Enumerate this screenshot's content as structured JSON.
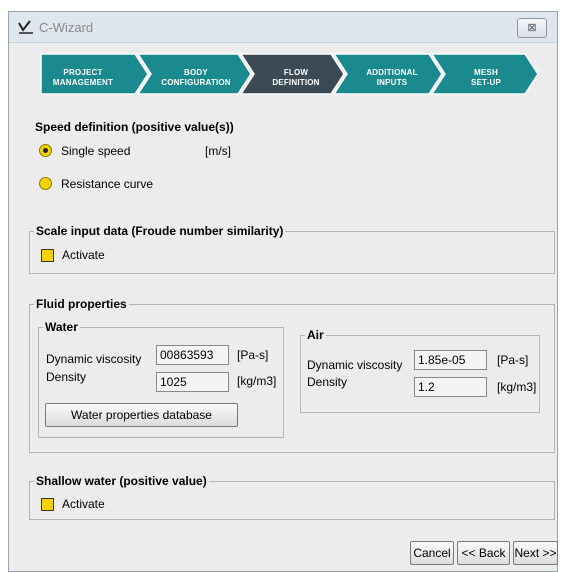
{
  "window": {
    "title": "C-Wizard",
    "close_symbol": "⊠",
    "app_icon": "checkmark-app-icon"
  },
  "wizard_steps": [
    {
      "line1": "PROJECT",
      "line2": "MANAGEMENT",
      "active": false
    },
    {
      "line1": "BODY",
      "line2": "CONFIGURATION",
      "active": false
    },
    {
      "line1": "FLOW",
      "line2": "DEFINITION",
      "active": true
    },
    {
      "line1": "ADDITIONAL",
      "line2": "INPUTS",
      "active": false
    },
    {
      "line1": "MESH",
      "line2": "SET-UP",
      "active": false
    }
  ],
  "colors": {
    "step": "#1a8a8e",
    "step_active": "#3b4a54",
    "checkbox": "#f5d300"
  },
  "speed": {
    "heading": "Speed definition (positive value(s))",
    "single_label": "Single speed",
    "unit": "[m/s]",
    "resistance_label": "Resistance curve",
    "selected": "single"
  },
  "scale": {
    "legend": "Scale input data (Froude number similarity)",
    "activate_label": "Activate"
  },
  "fluid": {
    "legend": "Fluid properties",
    "water": {
      "legend": "Water",
      "viscosity_label": "Dynamic viscosity",
      "viscosity_value": "00863593",
      "viscosity_unit": "[Pa-s]",
      "density_label": "Density",
      "density_value": "1025",
      "density_unit": "[kg/m3]",
      "db_button": "Water properties database"
    },
    "air": {
      "legend": "Air",
      "viscosity_label": "Dynamic viscosity",
      "viscosity_value": "1.85e-05",
      "viscosity_unit": "[Pa-s]",
      "density_label": "Density",
      "density_value": "1.2",
      "density_unit": "[kg/m3]"
    }
  },
  "shallow": {
    "legend": "Shallow water (positive value)",
    "activate_label": "Activate"
  },
  "nav": {
    "cancel": "Cancel",
    "back": "<< Back",
    "next": "Next >>"
  }
}
